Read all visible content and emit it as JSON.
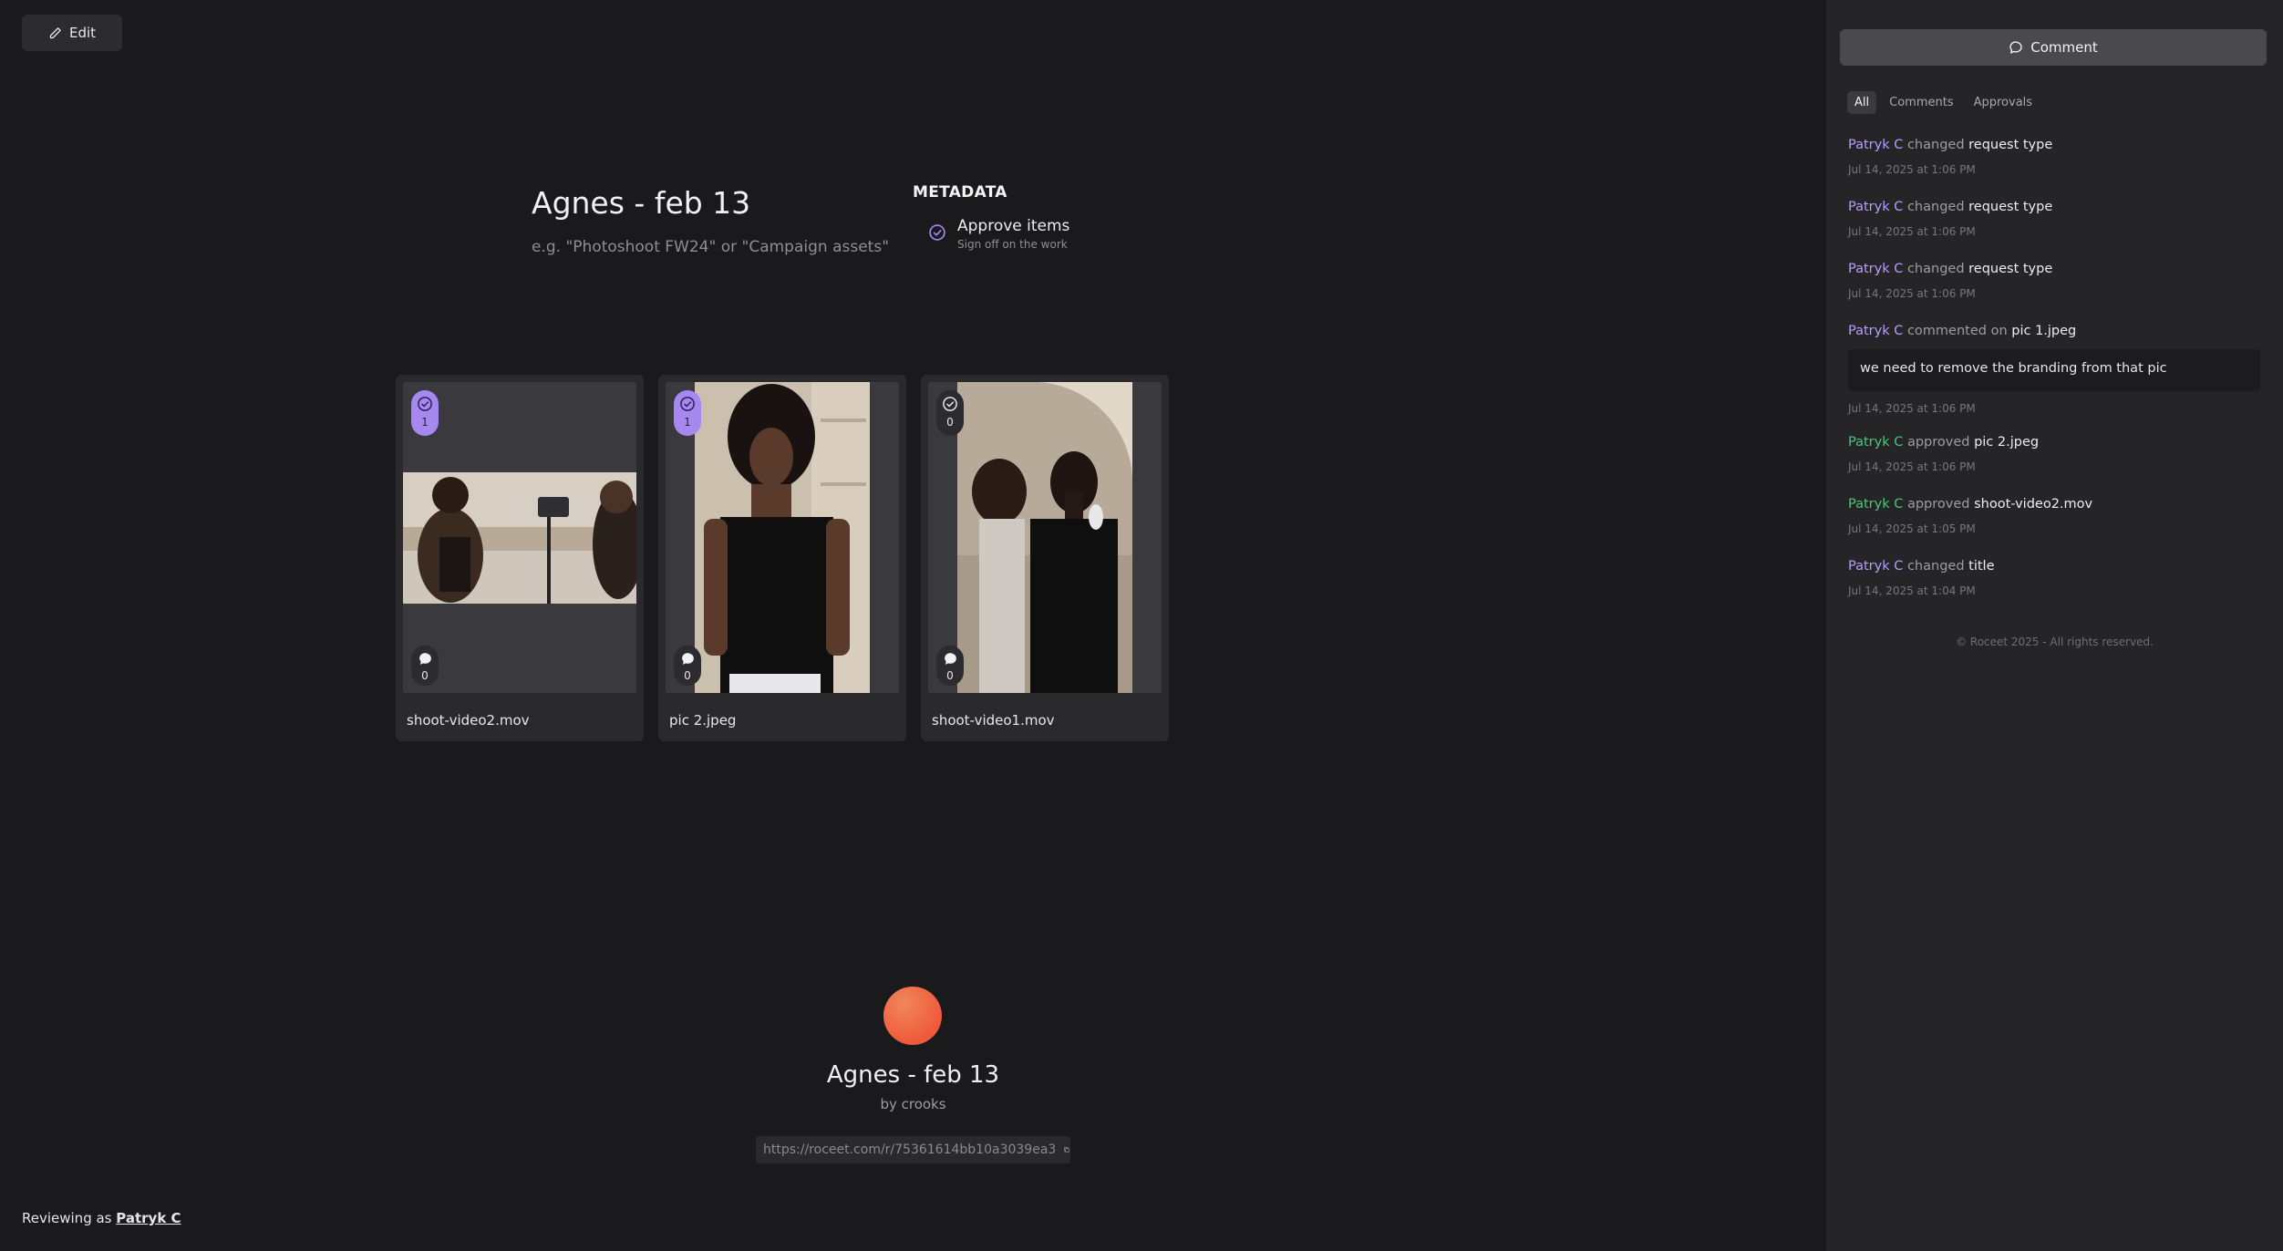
{
  "toolbar": {
    "edit_label": "Edit"
  },
  "project": {
    "title": "Agnes - feb 13",
    "placeholder": "e.g. \"Photoshoot FW24\" or \"Campaign assets\""
  },
  "metadata": {
    "heading": "METADATA",
    "item_title": "Approve items",
    "item_sub": "Sign off on the work"
  },
  "cards": [
    {
      "name": "shoot-video2.mov",
      "approvals": "1",
      "comments": "0",
      "approved": true
    },
    {
      "name": "pic 2.jpeg",
      "approvals": "1",
      "comments": "0",
      "approved": true
    },
    {
      "name": "shoot-video1.mov",
      "approvals": "0",
      "comments": "0",
      "approved": false
    }
  ],
  "footer_card": {
    "title": "Agnes - feb 13",
    "by": "by crooks",
    "link": "https://roceet.com/r/75361614bb10a3039ea3"
  },
  "reviewing": {
    "prefix": "Reviewing as",
    "user": "Patryk C"
  },
  "sidebar": {
    "comment_label": "Comment",
    "tabs": [
      "All",
      "Comments",
      "Approvals"
    ],
    "activity": [
      {
        "who": "Patryk C",
        "action": "changed",
        "object": "request type",
        "date": "Jul 14, 2025 at 1:06 PM"
      },
      {
        "who": "Patryk C",
        "action": "changed",
        "object": "request type",
        "date": "Jul 14, 2025 at 1:06 PM"
      },
      {
        "who": "Patryk C",
        "action": "changed",
        "object": "request type",
        "date": "Jul 14, 2025 at 1:06 PM"
      },
      {
        "who": "Patryk C",
        "action": "commented on",
        "object": "pic 1.jpeg",
        "quote": "we need to remove the branding from that pic",
        "date": "Jul 14, 2025 at 1:06 PM"
      },
      {
        "who": "Patryk C",
        "action": "approved",
        "object": "pic 2.jpeg",
        "date": "Jul 14, 2025 at 1:06 PM"
      },
      {
        "who": "Patryk C",
        "action": "approved",
        "object": "shoot-video2.mov",
        "date": "Jul 14, 2025 at 1:05 PM"
      },
      {
        "who": "Patryk C",
        "action": "changed",
        "object": "title",
        "date": "Jul 14, 2025 at 1:04 PM"
      }
    ],
    "footer": "© Roceet 2025 - All rights reserved."
  },
  "colors": {
    "accent": "#a688f0",
    "approved_green": "#46c77a",
    "user_purple": "#b79cff",
    "avatar": "#ee5a3a"
  }
}
